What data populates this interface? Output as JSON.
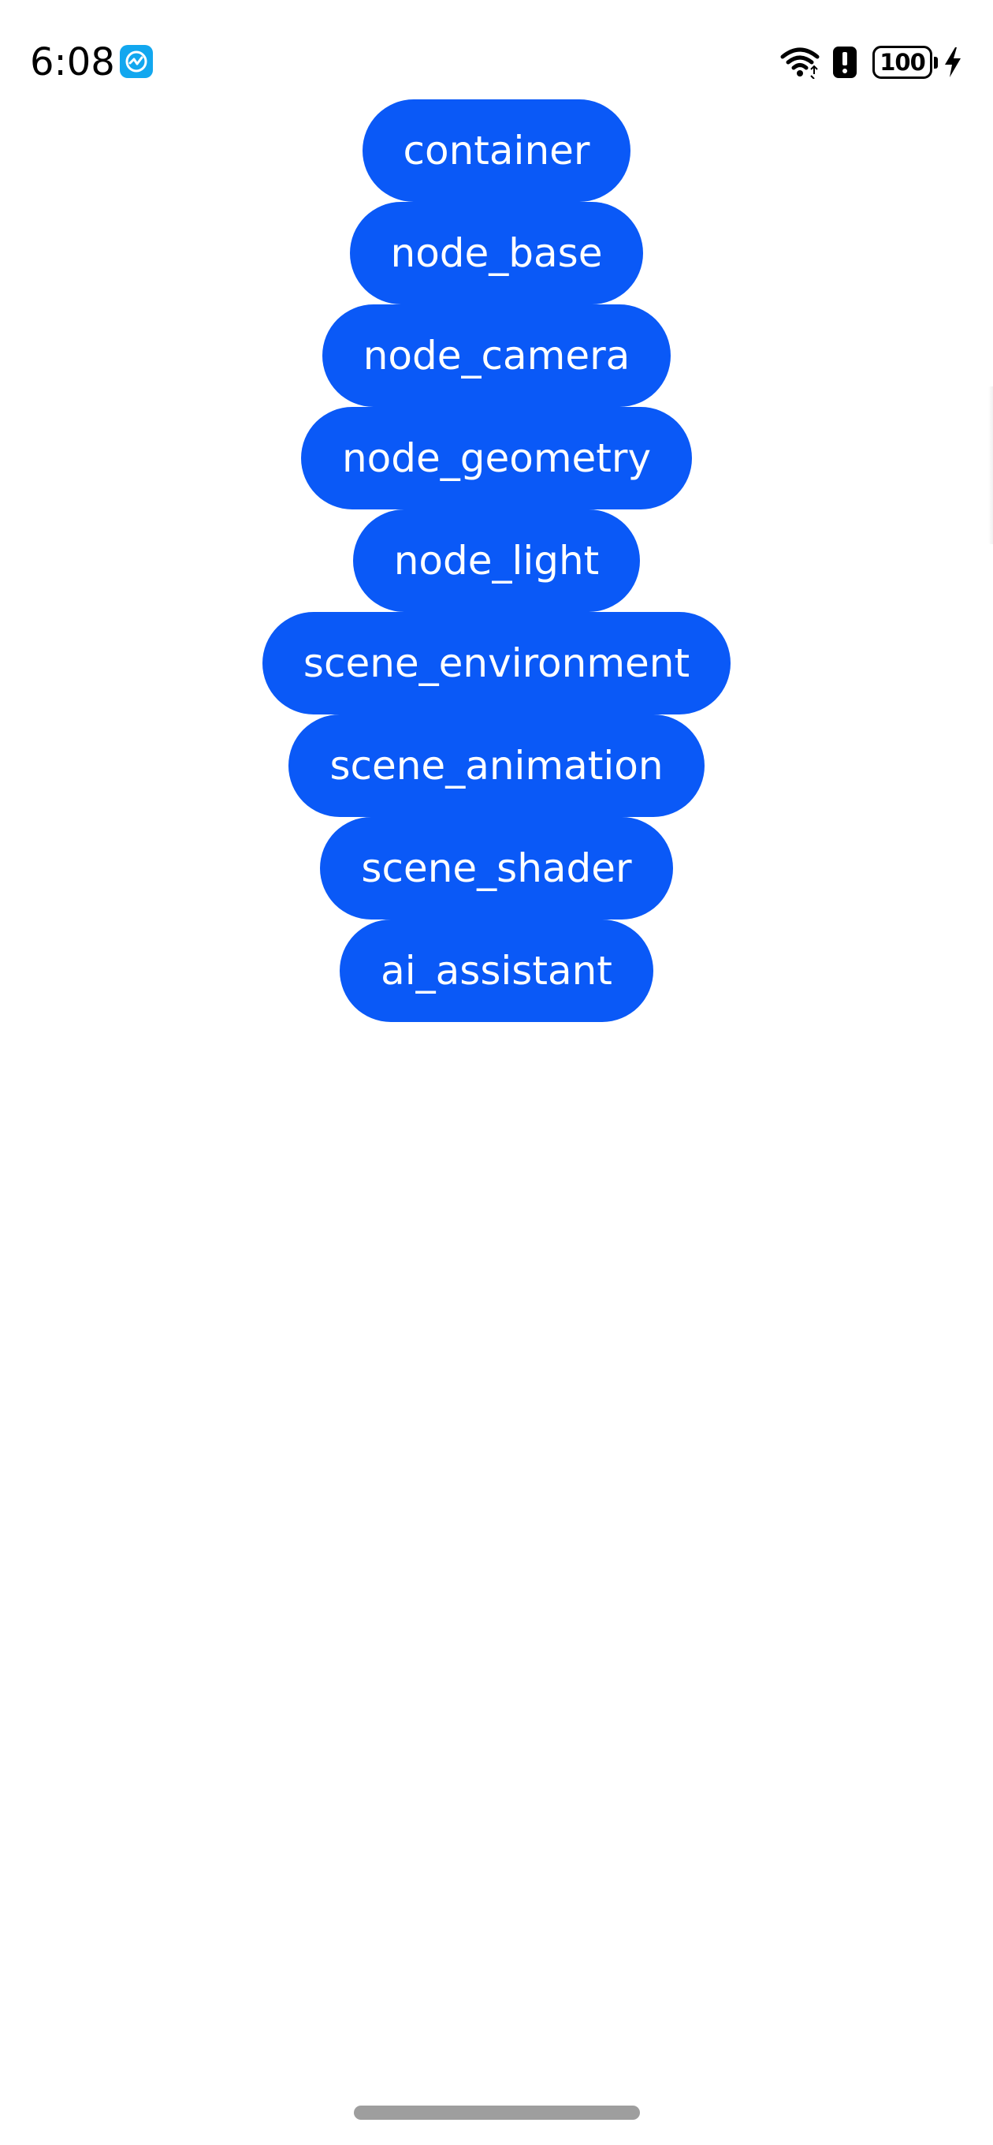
{
  "status_bar": {
    "time": "6:08",
    "app_badge_icon": "monitor-app-icon",
    "wifi_icon": "wifi-icon",
    "alert_icon": "alert-icon",
    "battery_level": "100",
    "charging_icon": "bolt-icon"
  },
  "buttons": [
    {
      "label": "container"
    },
    {
      "label": "node_base"
    },
    {
      "label": "node_camera"
    },
    {
      "label": "node_geometry"
    },
    {
      "label": "node_light"
    },
    {
      "label": "scene_environment"
    },
    {
      "label": "scene_animation"
    },
    {
      "label": "scene_shader"
    },
    {
      "label": "ai_assistant"
    }
  ],
  "colors": {
    "button_background": "#0a59f7",
    "button_text": "#ffffff",
    "page_background": "#ffffff",
    "app_badge": "#12a7ef"
  }
}
